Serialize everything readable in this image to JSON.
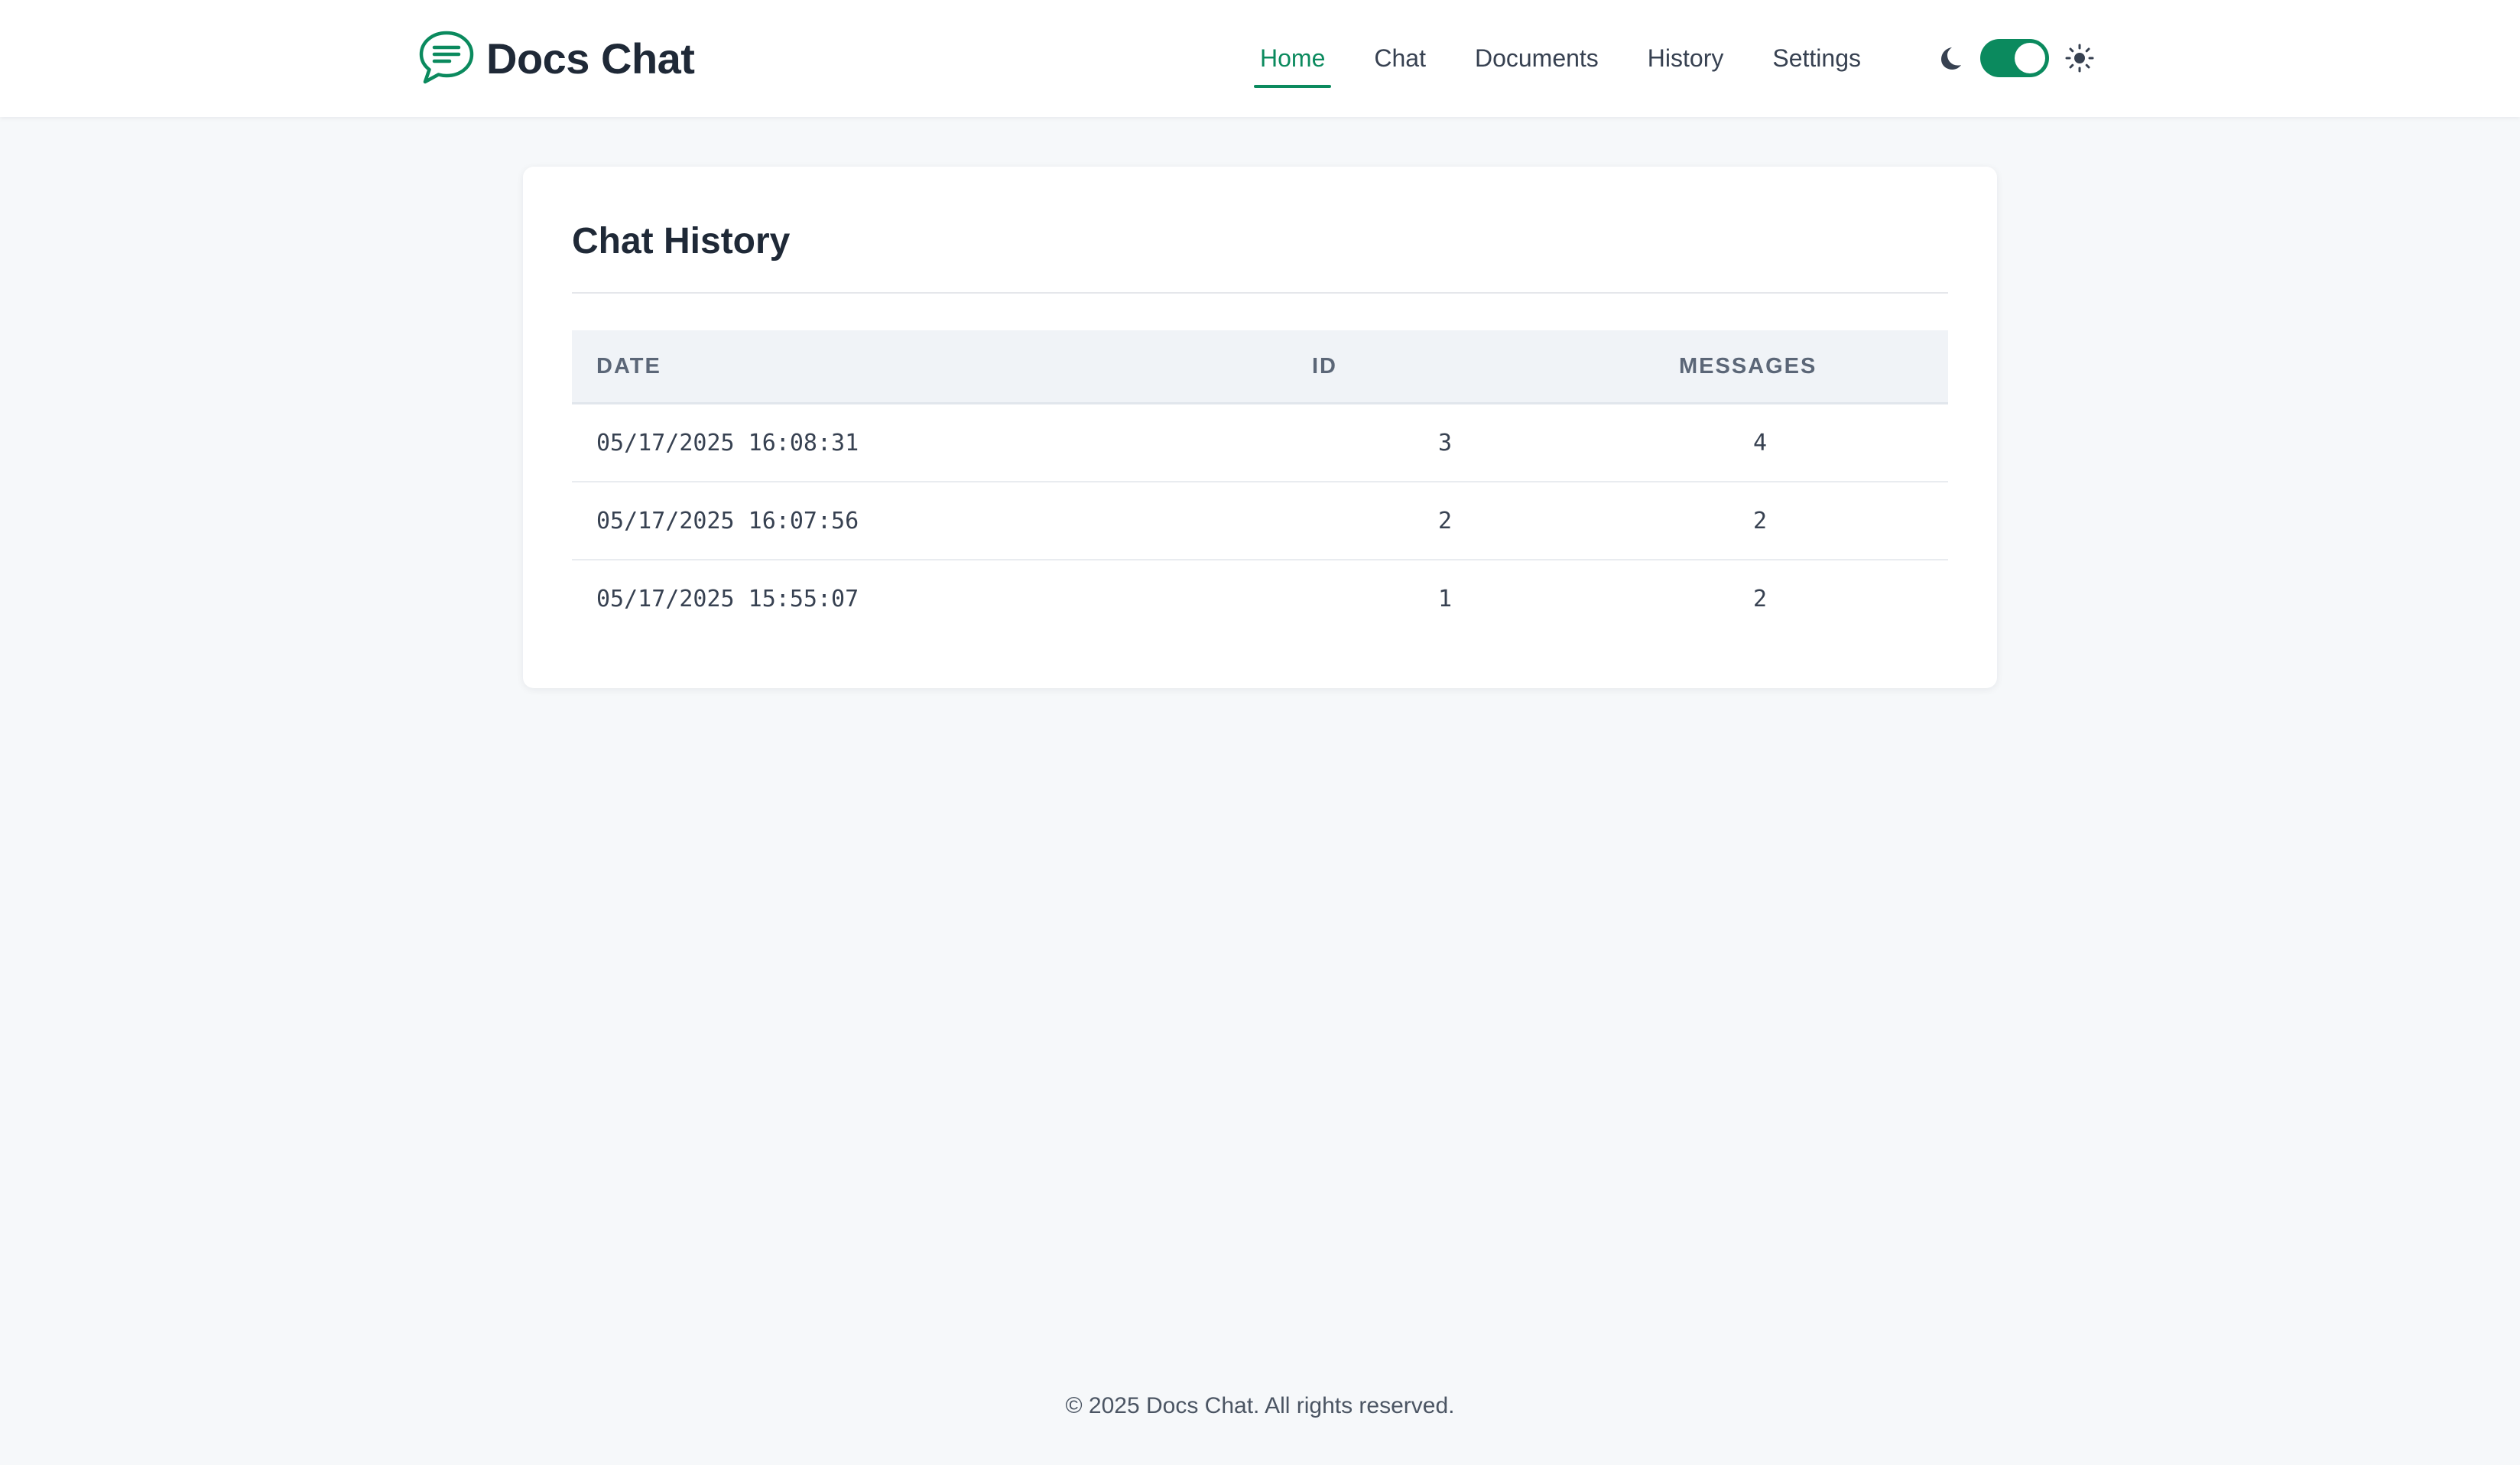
{
  "header": {
    "brand_title": "Docs Chat",
    "brand_icon": "chat-bubble-icon",
    "nav": [
      {
        "label": "Home",
        "active": true
      },
      {
        "label": "Chat",
        "active": false
      },
      {
        "label": "Documents",
        "active": false
      },
      {
        "label": "History",
        "active": false
      },
      {
        "label": "Settings",
        "active": false
      }
    ],
    "theme_toggle": {
      "left_icon": "moon-icon",
      "right_icon": "sun-icon",
      "state": "on"
    }
  },
  "main": {
    "title": "Chat History",
    "table": {
      "columns": [
        "DATE",
        "ID",
        "MESSAGES"
      ],
      "rows": [
        {
          "date": "05/17/2025 16:08:31",
          "id": "3",
          "messages": "4"
        },
        {
          "date": "05/17/2025 16:07:56",
          "id": "2",
          "messages": "2"
        },
        {
          "date": "05/17/2025 15:55:07",
          "id": "1",
          "messages": "2"
        }
      ]
    }
  },
  "footer": {
    "text": "© 2025 Docs Chat. All rights reserved."
  },
  "colors": {
    "accent": "#0b8a5e",
    "page_bg": "#f6f8fa",
    "card_bg": "#ffffff",
    "table_header_bg": "#f0f3f7"
  }
}
